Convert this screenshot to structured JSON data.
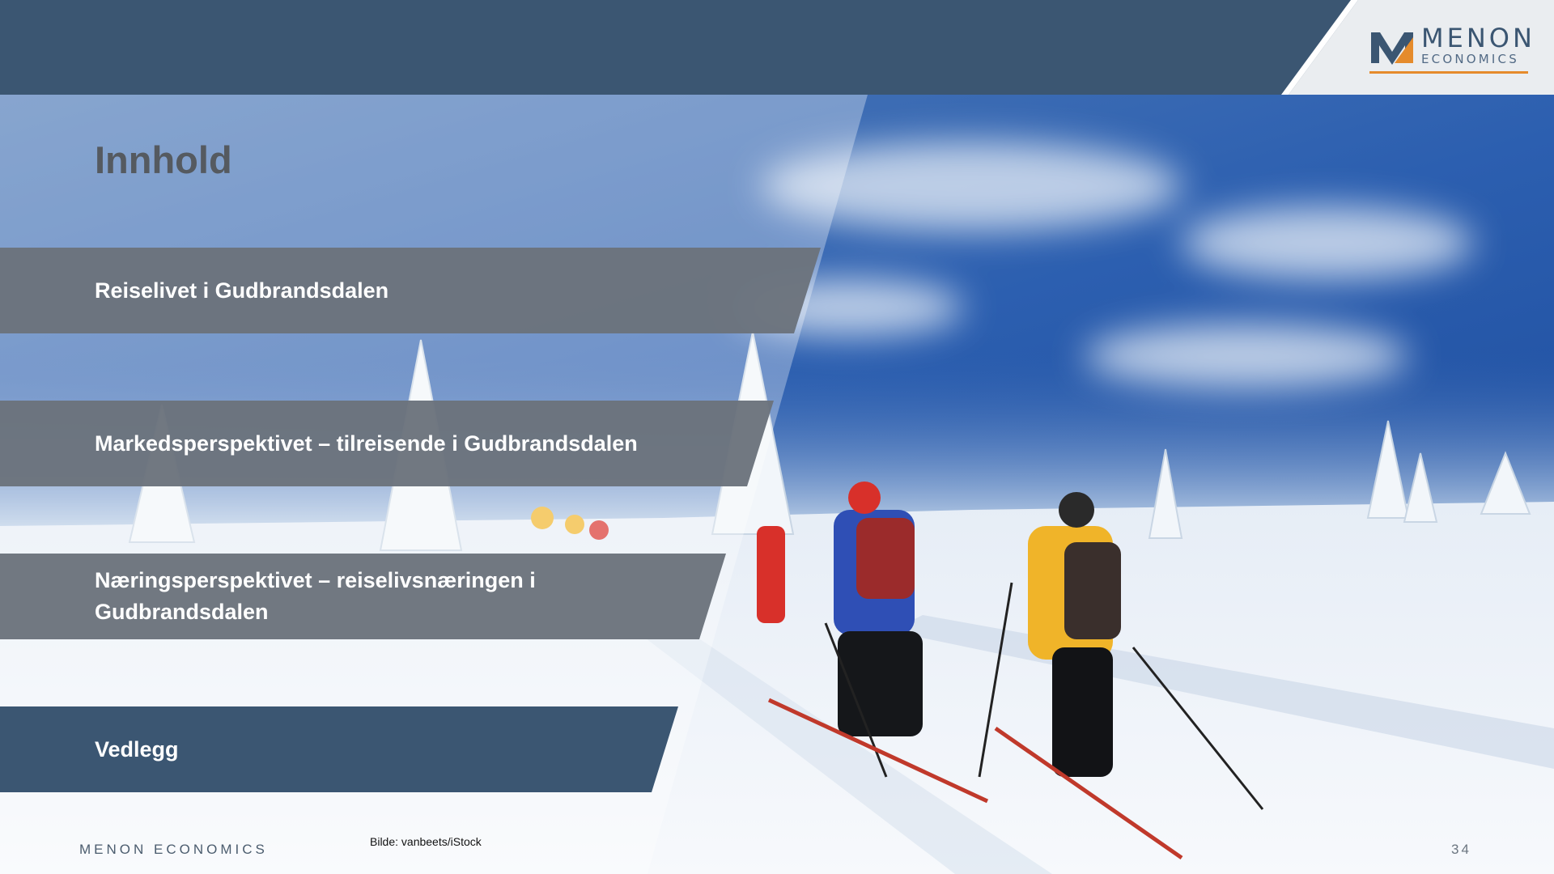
{
  "slide": {
    "title": "Innhold",
    "sections": [
      {
        "label": "Reiselivet i Gudbrandsdalen"
      },
      {
        "label": "Markedsperspektivet – tilreisende i Gudbrandsdalen"
      },
      {
        "label": "Næringsperspektivet – reiselivsnæringen i Gudbrandsdalen"
      },
      {
        "label": "Vedlegg"
      }
    ]
  },
  "logo": {
    "name": "MENON",
    "sub": "ECONOMICS"
  },
  "footer": {
    "brand": "MENON ECONOMICS",
    "credit": "Bilde: vanbeets/iStock",
    "page_number": "34"
  },
  "colors": {
    "navy": "#3b5672",
    "band_gray": "#6b737c",
    "logo_accent": "#e58b2c",
    "title_gray": "#555a60"
  }
}
